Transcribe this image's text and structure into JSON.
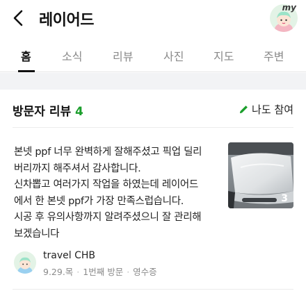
{
  "header": {
    "title": "레이어드",
    "back_icon": "back-arrow-icon",
    "profile_badge": "my"
  },
  "tabs": [
    {
      "label": "홈",
      "active": true
    },
    {
      "label": "소식",
      "active": false
    },
    {
      "label": "리뷰",
      "active": false
    },
    {
      "label": "사진",
      "active": false
    },
    {
      "label": "지도",
      "active": false
    },
    {
      "label": "주변",
      "active": false
    }
  ],
  "reviews_section": {
    "title": "방문자 리뷰",
    "count": "4",
    "write_label": "나도 참여",
    "accent_color": "#1a9e2b"
  },
  "review": {
    "lines": [
      "본넷 ppf 너무 완벽하게 잘해주셨고 픽업 딜리",
      "버리까지 해주셔서 감사합니다.",
      "신차뽑고 여러가지 작업을 하였는데 레이어드",
      "에서 한 본넷 ppf가 가장 만족스럽습니다.",
      "시공 후 유의사항까지 알려주셨으니 잘 관리해",
      "보겠습니다"
    ],
    "photo_count": "3",
    "author": "travel CHB",
    "date": "9.29.목",
    "visit": "1번째 방문",
    "receipt": "영수증"
  }
}
